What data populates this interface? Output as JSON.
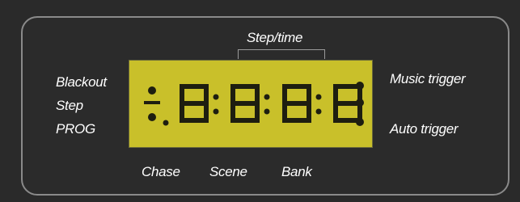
{
  "labels": {
    "step_time": "Step/time",
    "blackout": "Blackout",
    "step": "Step",
    "prog": "PROG",
    "music_trigger": "Music trigger",
    "auto_trigger": "Auto trigger",
    "chase": "Chase",
    "scene": "Scene",
    "bank": "Bank"
  },
  "display": {
    "digits": [
      "8",
      "8",
      "8",
      "8"
    ]
  },
  "colors": {
    "panel": "#2a2a2a",
    "lcd": "#c9c02a",
    "segment": "#1e1e10",
    "text": "#ffffff"
  }
}
